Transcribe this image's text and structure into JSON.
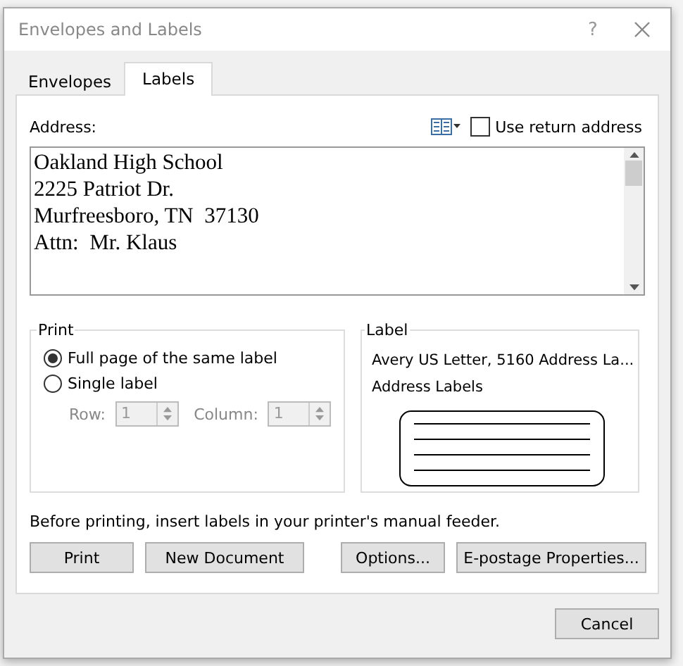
{
  "window": {
    "title": "Envelopes and Labels",
    "help": "?"
  },
  "tabs": [
    {
      "label": "Envelopes",
      "selected": false
    },
    {
      "label": "Labels",
      "selected": true
    }
  ],
  "address": {
    "label": "Address:",
    "value": "Oakland High School\n2225 Patriot Dr.\nMurfreesboro, TN  37130\nAttn:  Mr. Klaus",
    "use_return_address": {
      "label": "Use return address",
      "checked": false
    }
  },
  "print": {
    "title": "Print",
    "options": [
      {
        "label": "Full page of the same label",
        "selected": true
      },
      {
        "label": "Single label",
        "selected": false
      }
    ],
    "row": {
      "label": "Row:",
      "value": "1",
      "disabled": true
    },
    "column": {
      "label": "Column:",
      "value": "1",
      "disabled": true
    }
  },
  "label": {
    "title": "Label",
    "name": "Avery US Letter, 5160 Address La...",
    "description": "Address Labels"
  },
  "note": "Before printing, insert labels in your printer's manual feeder.",
  "buttons": [
    "Print",
    "New Document",
    "Options...",
    "E-postage Properties..."
  ],
  "cancel": "Cancel"
}
